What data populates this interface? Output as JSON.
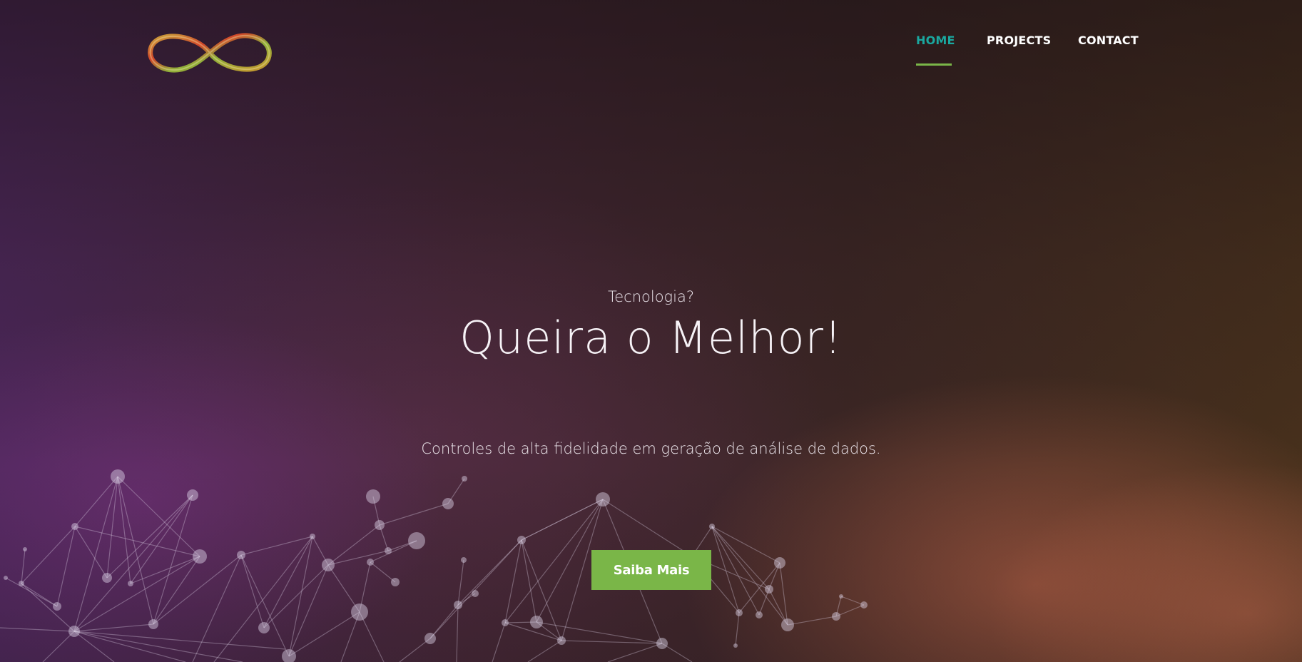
{
  "nav": {
    "items": [
      {
        "label": "HOME",
        "active": true
      },
      {
        "label": "PROJECTS",
        "active": false
      },
      {
        "label": "CONTACT",
        "active": false
      }
    ]
  },
  "logo": {
    "icon": "infinity-logo-icon"
  },
  "hero": {
    "subtitle": "Tecnologia?",
    "title": "Queira o Melhor!",
    "description": "Controles de alta fidelidade em geração de análise de dados.",
    "cta_label": "Saiba Mais"
  },
  "colors": {
    "accent_green": "#7ab648",
    "active_nav": "#1aa8a0"
  }
}
